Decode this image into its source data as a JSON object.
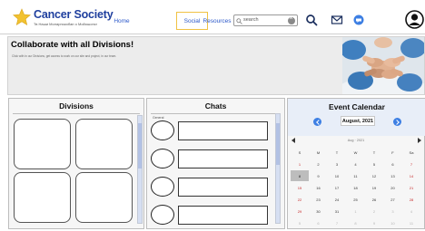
{
  "brand": {
    "name": "Cancer Society",
    "tagline": "Тв Наши Моларпокобан о Мойошонсг"
  },
  "nav": {
    "home": "Home",
    "social": "Social",
    "resources": "Resources"
  },
  "search": {
    "placeholder": "search"
  },
  "banner": {
    "title": "Collaborate with all Divisions!",
    "description": "Сlick with in our Divisions, get access to work on our site and project, in our team."
  },
  "divisions": {
    "title": "Divisions"
  },
  "chats": {
    "title": "Chats",
    "label": "General"
  },
  "calendar": {
    "title": "Event Calendar",
    "month_label": "August, 2021",
    "sub_label": "Aug · 2021",
    "weekdays": [
      "S",
      "M",
      "T",
      "W",
      "T",
      "F",
      "Sa"
    ],
    "weeks": [
      [
        "1",
        "2",
        "3",
        "4",
        "5",
        "6",
        "7"
      ],
      [
        "8",
        "9",
        "10",
        "11",
        "12",
        "13",
        "14"
      ],
      [
        "15",
        "16",
        "17",
        "18",
        "19",
        "20",
        "21"
      ],
      [
        "22",
        "23",
        "24",
        "25",
        "26",
        "27",
        "28"
      ],
      [
        "29",
        "30",
        "31",
        "1",
        "2",
        "3",
        "4"
      ],
      [
        "5",
        "6",
        "7",
        "8",
        "9",
        "10",
        "11"
      ]
    ],
    "selected_day": "8"
  },
  "colors": {
    "brand_blue": "#1f3f9e",
    "link_blue": "#2a57c9",
    "active_tab_border": "#f0c244",
    "calendar_nav": "#3d7fe3",
    "weekend_red": "#c62828"
  }
}
